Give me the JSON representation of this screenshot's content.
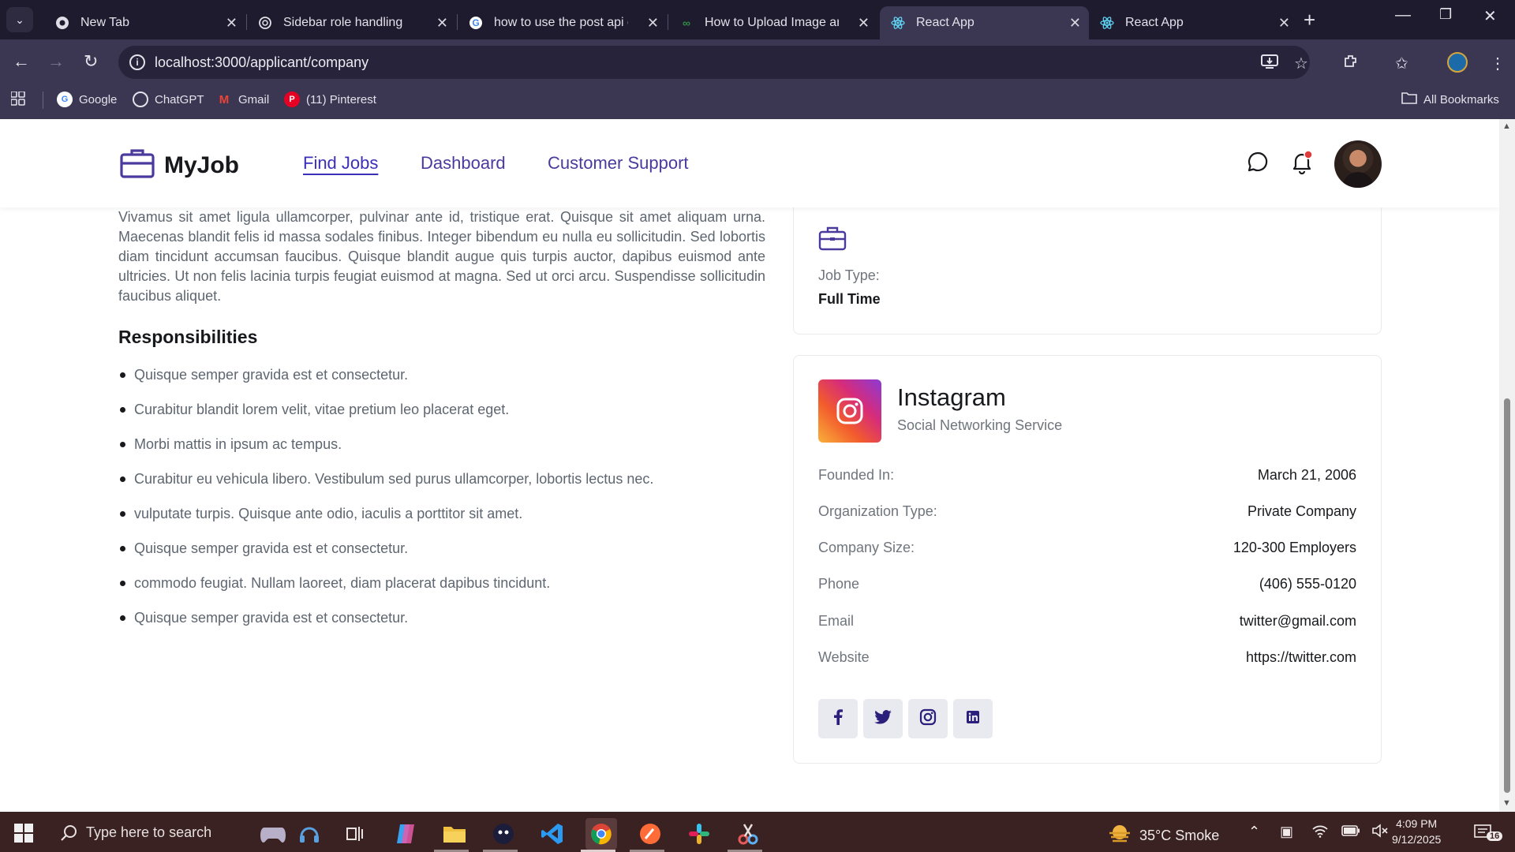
{
  "browser": {
    "tabs": [
      {
        "title": "New Tab",
        "icon": "chrome-icon"
      },
      {
        "title": "Sidebar role handling",
        "icon": "chatgpt-icon"
      },
      {
        "title": "how to use the post api of",
        "icon": "google-icon"
      },
      {
        "title": "How to Upload Image and",
        "icon": "geeksforgeeks-icon"
      },
      {
        "title": "React App",
        "icon": "react-icon"
      },
      {
        "title": "React App",
        "icon": "react-icon"
      }
    ],
    "url": "localhost:3000/applicant/company",
    "bookmarks": [
      {
        "label": "Google"
      },
      {
        "label": "ChatGPT"
      },
      {
        "label": "Gmail"
      },
      {
        "label": "(11) Pinterest"
      }
    ],
    "all_bookmarks": "All Bookmarks"
  },
  "site": {
    "logo": "MyJob",
    "menu": [
      "Find Jobs",
      "Dashboard",
      "Customer Support"
    ],
    "active_menu": "Find Jobs"
  },
  "main": {
    "paragraph": "Vivamus sit amet ligula ullamcorper, pulvinar ante id, tristique erat. Quisque sit amet aliquam urna. Maecenas blandit felis id massa sodales finibus. Integer bibendum eu nulla eu sollicitudin. Sed lobortis diam tincidunt accumsan faucibus. Quisque blandit augue quis turpis auctor, dapibus euismod ante ultricies. Ut non felis lacinia turpis feugiat euismod at magna. Sed ut orci arcu. Suspendisse sollicitudin faucibus aliquet.",
    "responsibilities_title": "Responsibilities",
    "responsibilities": [
      "Quisque semper gravida est et consectetur.",
      "Curabitur blandit lorem velit, vitae pretium leo placerat eget.",
      "Morbi mattis in ipsum ac tempus.",
      "Curabitur eu vehicula libero. Vestibulum sed purus ullamcorper, lobortis lectus nec.",
      "vulputate turpis. Quisque ante odio, iaculis a porttitor sit amet.",
      "Quisque semper gravida est et consectetur.",
      "commodo feugiat. Nullam laoreet, diam placerat dapibus tincidunt.",
      "Quisque semper gravida est et consectetur."
    ]
  },
  "job_overview": {
    "label": "Job Type:",
    "value": "Full Time"
  },
  "company": {
    "name": "Instagram",
    "subtitle": "Social Networking Service",
    "rows": [
      {
        "key": "Founded In:",
        "value": "March 21, 2006"
      },
      {
        "key": "Organization Type:",
        "value": "Private Company"
      },
      {
        "key": "Company Size:",
        "value": "120-300 Employers"
      },
      {
        "key": "Phone",
        "value": "(406) 555-0120"
      },
      {
        "key": "Email",
        "value": "twitter@gmail.com"
      },
      {
        "key": "Website",
        "value": "https://twitter.com"
      }
    ],
    "socials": [
      "facebook-icon",
      "twitter-icon",
      "instagram-icon",
      "linkedin-icon"
    ]
  },
  "taskbar": {
    "search_placeholder": "Type here to search",
    "weather": "35°C  Smoke",
    "time": "4:09 PM",
    "date": "9/12/2025",
    "notifications": "16"
  },
  "colors": {
    "brand": "#4b3a9e",
    "chrome_dark": "#1f1b2e",
    "chrome_mid": "#3b3752",
    "taskbar": "#3a2222"
  }
}
